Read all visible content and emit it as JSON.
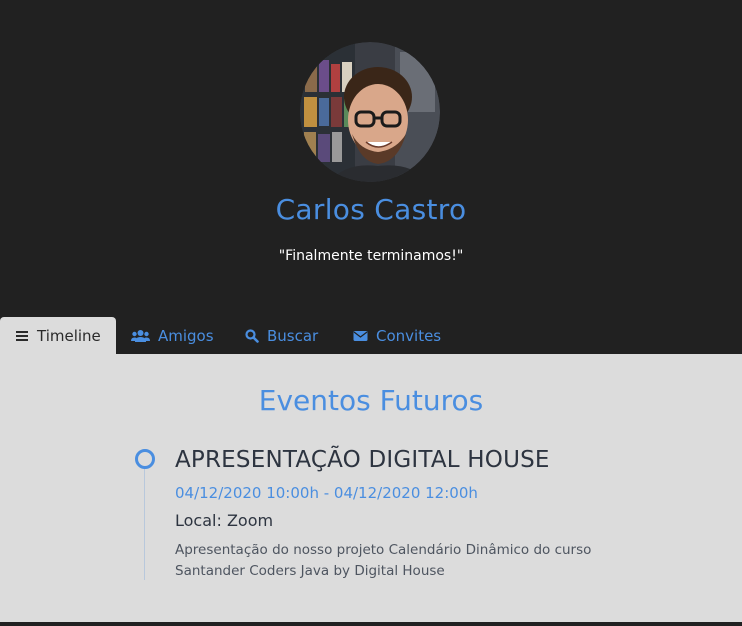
{
  "profile": {
    "name": "Carlos Castro",
    "quote": "\"Finalmente terminamos!\""
  },
  "tabs": [
    {
      "label": "Timeline",
      "icon": "list-icon",
      "active": true
    },
    {
      "label": "Amigos",
      "icon": "users-icon",
      "active": false
    },
    {
      "label": "Buscar",
      "icon": "search-icon",
      "active": false
    },
    {
      "label": "Convites",
      "icon": "envelope-icon",
      "active": false
    }
  ],
  "timeline": {
    "section_title": "Eventos Futuros",
    "events": [
      {
        "title": "APRESENTAÇÃO DIGITAL HOUSE",
        "datetime": "04/12/2020 10:00h - 04/12/2020 12:00h",
        "location": "Local: Zoom",
        "description": "Apresentação do nosso projeto Calendário Dinâmico do curso Santander Coders Java by Digital House"
      }
    ]
  },
  "colors": {
    "header_bg": "#212121",
    "accent": "#4a8ee0",
    "content_bg": "#dcdcdc",
    "text_dark": "#2d3440"
  }
}
